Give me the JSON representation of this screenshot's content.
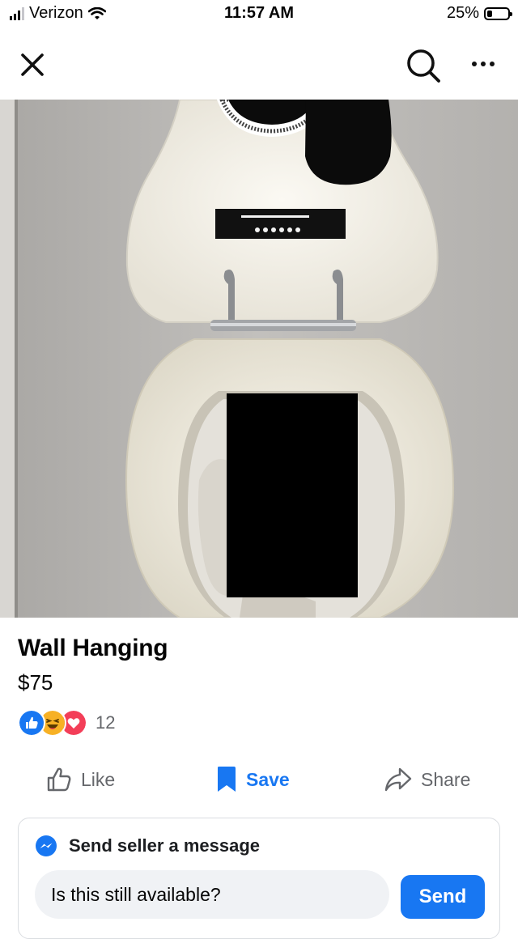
{
  "status_bar": {
    "carrier": "Verizon",
    "time": "11:57 AM",
    "battery_percent": "25%",
    "battery_level": 0.25
  },
  "nav": {
    "icons": [
      "close-icon",
      "search-icon",
      "more-icon"
    ]
  },
  "listing": {
    "title": "Wall Hanging",
    "price": "$75",
    "reactions": {
      "types": [
        "like",
        "haha",
        "love"
      ],
      "count": "12"
    }
  },
  "actions": {
    "like_label": "Like",
    "save_label": "Save",
    "share_label": "Share"
  },
  "message": {
    "header": "Send seller a message",
    "input_value": "Is this still available?",
    "send_label": "Send"
  },
  "colors": {
    "accent": "#1877f2",
    "secondary_text": "#65676b",
    "input_bg": "#f0f2f5",
    "love_red": "#f33e58",
    "haha_yellow": "#f7b125"
  }
}
